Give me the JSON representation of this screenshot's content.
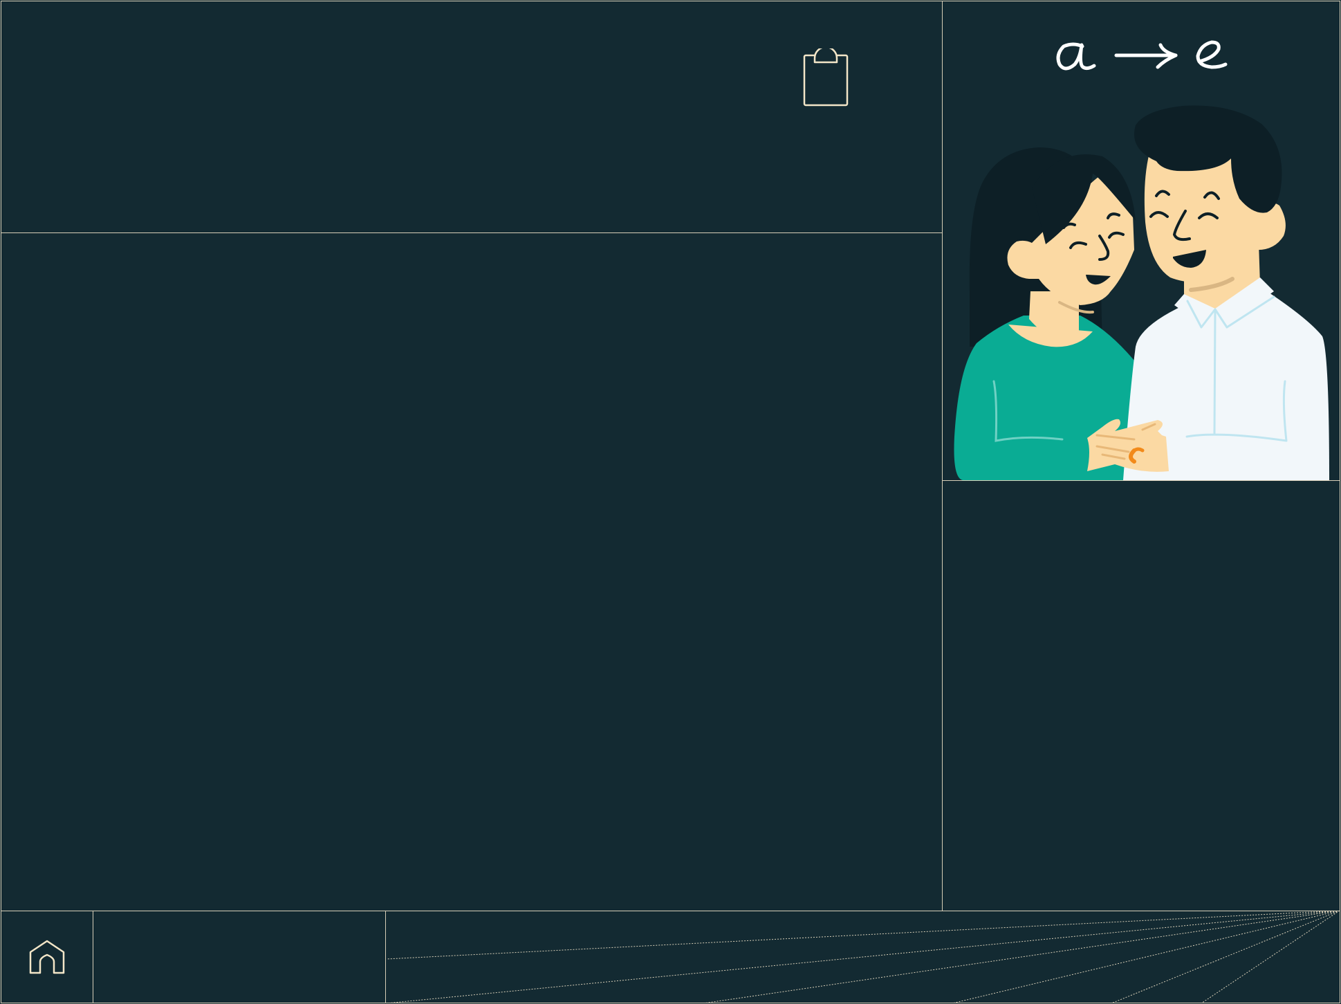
{
  "illustration": {
    "header_formula": "a → e",
    "icon": "couple-illustration"
  },
  "toolbar": {
    "clipboard_icon": "clipboard-icon"
  },
  "footer": {
    "home_icon": "home-icon"
  },
  "colors": {
    "background": "#132a32",
    "border": "#d8cfb8",
    "accent_teal": "#0aac94",
    "skin": "#fbd9a3",
    "shirt_white": "#f2f7fa",
    "hair": "#0d1f26",
    "ring": "#f28a1a"
  }
}
